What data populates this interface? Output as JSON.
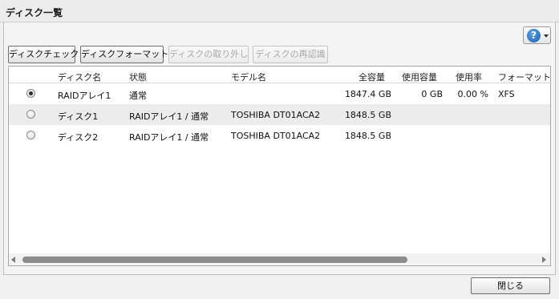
{
  "window": {
    "title": "ディスク一覧"
  },
  "toolbar": {
    "help_icon_glyph": "?",
    "buttons": [
      {
        "label": "ディスクチェック",
        "enabled": true
      },
      {
        "label": "ディスクフォーマット",
        "enabled": true
      },
      {
        "label": "ディスクの取り外し",
        "enabled": false
      },
      {
        "label": "ディスクの再認識",
        "enabled": false
      }
    ]
  },
  "table": {
    "columns": [
      "ディスク名",
      "状態",
      "モデル名",
      "全容量",
      "使用容量",
      "使用率",
      "フォーマット"
    ],
    "rows": [
      {
        "selected": true,
        "name": "RAIDアレイ1",
        "status": "通常",
        "model": "",
        "capacity": "1847.4 GB",
        "used": "0 GB",
        "usage": "0.00 %",
        "format": "XFS"
      },
      {
        "selected": false,
        "name": "ディスク1",
        "status": "RAIDアレイ1 / 通常",
        "model": "TOSHIBA DT01ACA2",
        "capacity": "1848.5 GB",
        "used": "",
        "usage": "",
        "format": ""
      },
      {
        "selected": false,
        "name": "ディスク2",
        "status": "RAIDアレイ1 / 通常",
        "model": "TOSHIBA DT01ACA2",
        "capacity": "1848.5 GB",
        "used": "",
        "usage": "",
        "format": ""
      }
    ]
  },
  "footer": {
    "close_label": "閉じる"
  },
  "colors": {
    "selected_row_bg": "#ececec",
    "help_icon": "#1b5fb0"
  }
}
